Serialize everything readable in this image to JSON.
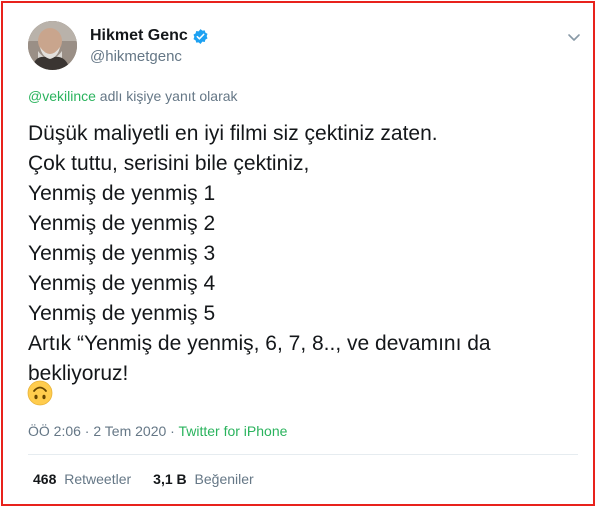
{
  "author": {
    "name": "Hikmet Genc",
    "handle": "@hikmetgenc"
  },
  "reply": {
    "mention": "@vekilince",
    "suffix": " adlı kişiye yanıt olarak"
  },
  "tweet": {
    "lines": [
      "Düşük maliyetli en iyi filmi siz çektiniz zaten.",
      "Çok tuttu, serisini bile çektiniz,",
      "Yenmiş de yenmiş 1",
      "Yenmiş de yenmiş 2",
      "Yenmiş de yenmiş 3",
      "Yenmiş de yenmiş 4",
      "Yenmiş de yenmiş 5",
      "Artık “Yenmiş de yenmiş, 6, 7, 8.., ve devamını da",
      "bekliyoruz!"
    ],
    "emoji": "upside-down-face"
  },
  "meta": {
    "time_date": "ÖÖ 2:06 · 2 Tem 2020 · ",
    "source": "Twitter for iPhone"
  },
  "stats": {
    "retweets_count": "468",
    "retweets_label": "Retweetler",
    "likes_count": "3,1 B",
    "likes_label": "Beğeniler"
  },
  "colors": {
    "accent_link": "#2ab35d",
    "verified": "#1da1f2",
    "frame": "#e8221c"
  },
  "icons": [
    "avatar",
    "verified-badge-icon",
    "chevron-down-icon",
    "upside-down-face-emoji"
  ]
}
